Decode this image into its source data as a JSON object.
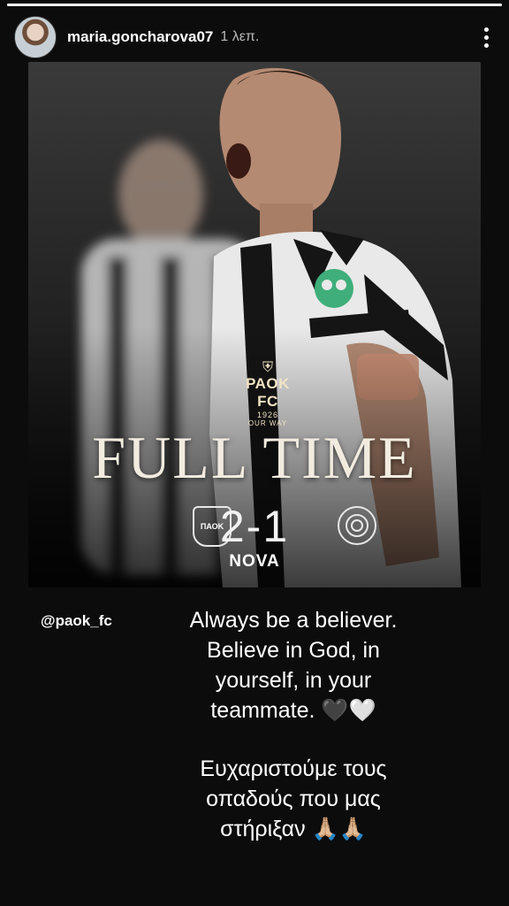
{
  "story": {
    "progress_fraction": 1.0
  },
  "header": {
    "username": "maria.goncharova07",
    "time": "1 λεπ.",
    "more_icon": "more-vertical-icon"
  },
  "poster": {
    "club": {
      "name": "PAOK FC",
      "year": "1926",
      "tagline": "OUR WAY"
    },
    "headline": "FULL TIME",
    "home_badge_text": "ΠΑΟΚ",
    "score": "2-1",
    "sponsor": "NOVA",
    "colors": {
      "cream": "#f2ece0",
      "kit_white": "#e9e9e9",
      "kit_black": "#151515",
      "sponsor_green": "#3fae7a"
    }
  },
  "mention": "@paok_fc",
  "caption": {
    "english": "Always be a believer. Believe in God, in yourself, in your teammate. 🖤🤍",
    "greek": "Ευχαριστούμε τους οπαδούς που μας στήριξαν 🙏🏼🙏🏼"
  }
}
